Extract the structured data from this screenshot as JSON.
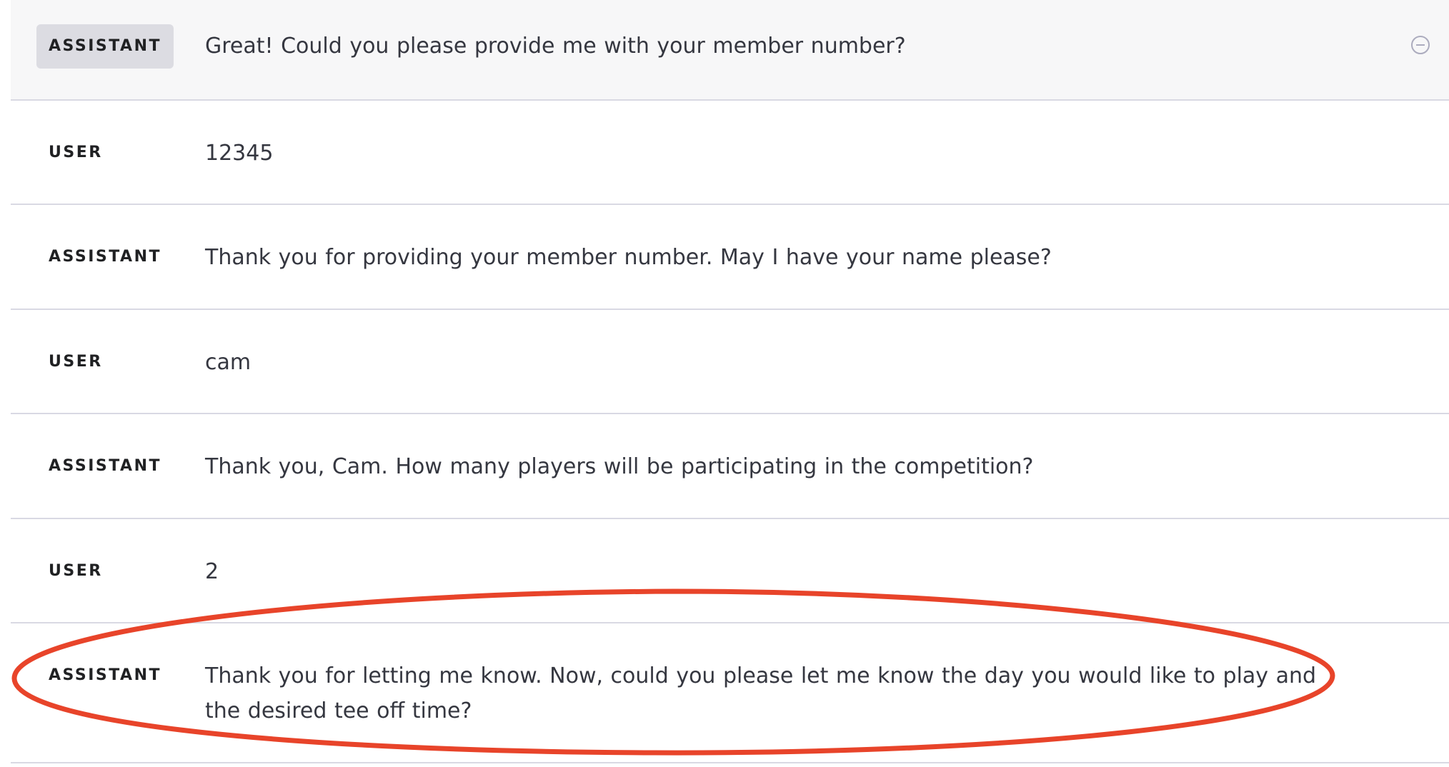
{
  "messages": [
    {
      "role": "ASSISTANT",
      "content": "Great! Could you please provide me with your member number?"
    },
    {
      "role": "USER",
      "content": "12345"
    },
    {
      "role": "ASSISTANT",
      "content": "Thank you for providing your member number. May I have your name please?"
    },
    {
      "role": "USER",
      "content": "cam"
    },
    {
      "role": "ASSISTANT",
      "content": "Thank you, Cam. How many players will be participating in the competition?"
    },
    {
      "role": "USER",
      "content": "2"
    },
    {
      "role": "ASSISTANT",
      "content": "Thank you for letting me know. Now, could you please let me know the day you would like to play and the desired tee off time?"
    }
  ],
  "icons": {
    "remove": "minus-circle-icon"
  },
  "colors": {
    "annotation": "#e8442a",
    "hover_row": "#f7f7f8",
    "role_chip": "#dcdce2",
    "divider": "#d9d9e3"
  }
}
